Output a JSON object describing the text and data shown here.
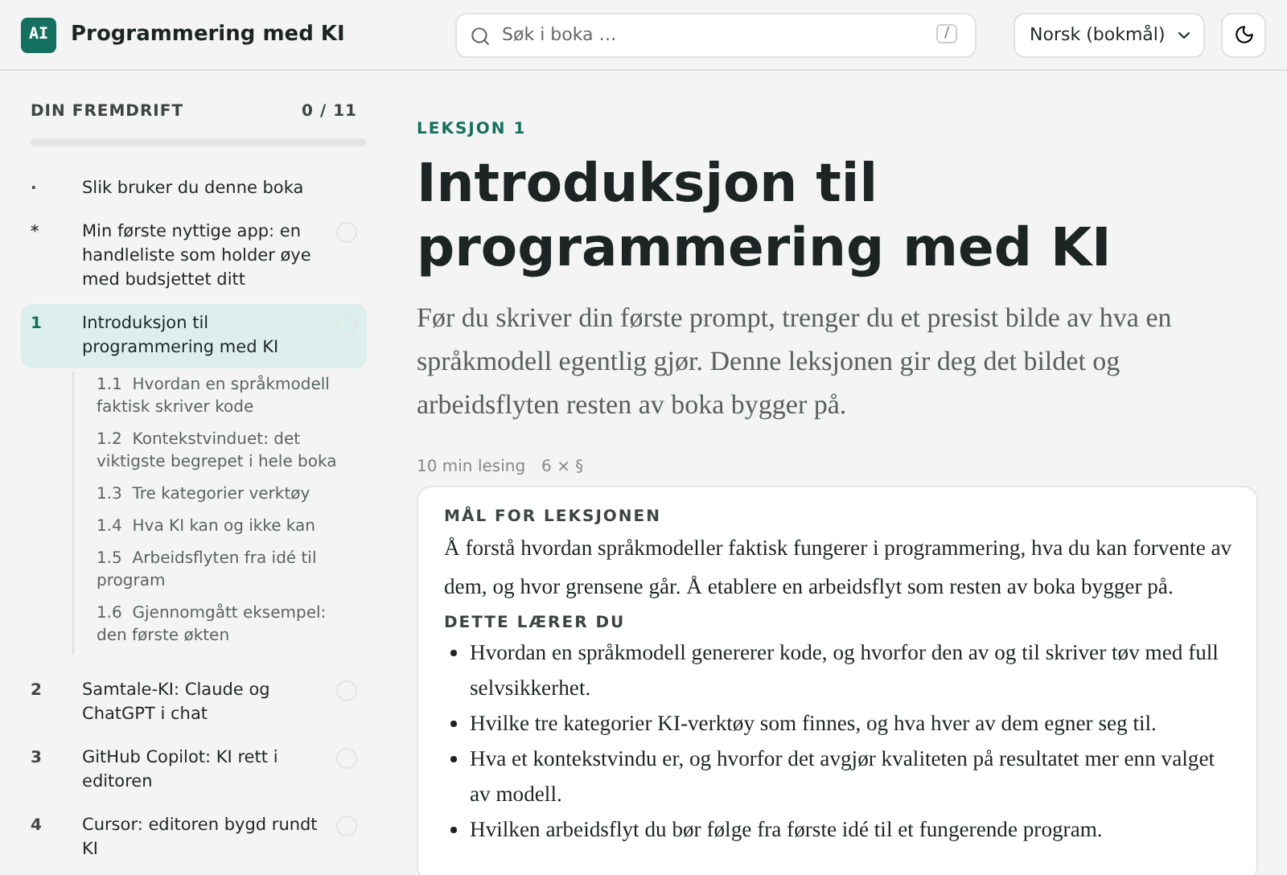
{
  "header": {
    "logo": "AI",
    "title": "Programmering med KI",
    "search": {
      "placeholder": "Søk i boka …",
      "shortcut": "/"
    },
    "language": "Norsk (bokmål)"
  },
  "sidebar": {
    "progress": {
      "label": "DIN FREMDRIFT",
      "count": "0 / 11",
      "level": 0
    },
    "chapters": [
      {
        "marker": "·",
        "title": "Slik bruker du denne boka",
        "selected": false
      },
      {
        "marker": "*",
        "title": "Min første nyttige app: en handleliste som holder øye med budsjettet ditt",
        "selected": false,
        "done": false
      },
      {
        "marker": "1",
        "title": "Introduksjon til programmering med KI",
        "selected": true,
        "done": false,
        "children": [
          {
            "number": "1.1",
            "title": "Hvordan en språkmodell faktisk skriver kode"
          },
          {
            "number": "1.2",
            "title": "Kontekstvinduet: det viktigste begrepet i hele boka"
          },
          {
            "number": "1.3",
            "title": "Tre kategorier verktøy"
          },
          {
            "number": "1.4",
            "title": "Hva KI kan og ikke kan"
          },
          {
            "number": "1.5",
            "title": "Arbeidsflyten fra idé til program"
          },
          {
            "number": "1.6",
            "title": "Gjennomgått eksempel: den første økten"
          }
        ]
      },
      {
        "marker": "2",
        "title": "Samtale-KI: Claude og ChatGPT i chat",
        "selected": false,
        "done": false
      },
      {
        "marker": "3",
        "title": "GitHub Copilot: KI rett i editoren",
        "selected": false,
        "done": false
      },
      {
        "marker": "4",
        "title": "Cursor: editoren bygd rundt KI",
        "selected": false,
        "done": false
      }
    ]
  },
  "lesson": {
    "eyebrow": "LEKSJON 1",
    "title": "Introduksjon til programmering med KI",
    "lead": "Før du skriver din første prompt, trenger du et presist bilde av hva en språkmodell egentlig gjør. Denne leksjonen gir deg det bildet og arbeidsflyten resten av boka bygger på.",
    "meta": [
      "10 min lesing",
      "6 × §"
    ],
    "goals": {
      "heading": "MÅL FOR LEKSJONEN",
      "text": "Å forstå hvordan språkmodeller faktisk fungerer i programmering, hva du kan forvente av dem, og hvor grensene går. Å etablere en arbeidsflyt som resten av boka bygger på.",
      "learn_heading": "DETTE LÆRER DU",
      "learn": [
        "Hvordan en språkmodell genererer kode, og hvorfor den av og til skriver tøv med full selvsikkerhet.",
        "Hvilke tre kategorier KI-verktøy som finnes, og hva hver av dem egner seg til.",
        "Hva et kontekstvindu er, og hvorfor det avgjør kvaliteten på resultatet mer enn valget av modell.",
        "Hvilken arbeidsflyt du bør følge fra første idé til et fungerende program."
      ]
    }
  }
}
